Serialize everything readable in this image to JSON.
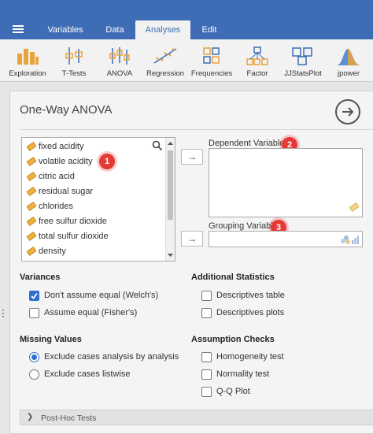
{
  "menu": {
    "tabs": [
      {
        "label": "Variables"
      },
      {
        "label": "Data"
      },
      {
        "label": "Analyses"
      },
      {
        "label": "Edit"
      }
    ]
  },
  "ribbon": {
    "items": [
      {
        "label": "Exploration"
      },
      {
        "label": "T-Tests"
      },
      {
        "label": "ANOVA"
      },
      {
        "label": "Regression"
      },
      {
        "label": "Frequencies"
      },
      {
        "label": "Factor"
      },
      {
        "label": "JJStatsPlot"
      },
      {
        "label": "jpower"
      }
    ]
  },
  "panel": {
    "title": "One-Way ANOVA",
    "variables": [
      "fixed acidity",
      "volatile acidity",
      "citric acid",
      "residual sugar",
      "chlorides",
      "free sulfur dioxide",
      "total sulfur dioxide",
      "density"
    ],
    "dependent_label": "Dependent Variables",
    "grouping_label": "Grouping Variable",
    "arrow_glyph": "→",
    "badges": [
      "1",
      "2",
      "3"
    ]
  },
  "variances": {
    "title": "Variances",
    "options": [
      {
        "label": "Don't assume equal (Welch's)",
        "checked": true
      },
      {
        "label": "Assume equal (Fisher's)",
        "checked": false
      }
    ]
  },
  "additional": {
    "title": "Additional Statistics",
    "options": [
      {
        "label": "Descriptives table",
        "checked": false
      },
      {
        "label": "Descriptives plots",
        "checked": false
      }
    ]
  },
  "missing": {
    "title": "Missing Values",
    "options": [
      {
        "label": "Exclude cases analysis by analysis",
        "selected": true
      },
      {
        "label": "Exclude cases listwise",
        "selected": false
      }
    ]
  },
  "assumptions": {
    "title": "Assumption Checks",
    "options": [
      {
        "label": "Homogeneity test",
        "checked": false
      },
      {
        "label": "Normality test",
        "checked": false
      },
      {
        "label": "Q-Q Plot",
        "checked": false
      }
    ]
  },
  "posthoc": {
    "label": "Post-Hoc Tests"
  },
  "colors": {
    "accent": "#3e6db5",
    "badge": "#e53935",
    "check": "#2f6fcb"
  }
}
